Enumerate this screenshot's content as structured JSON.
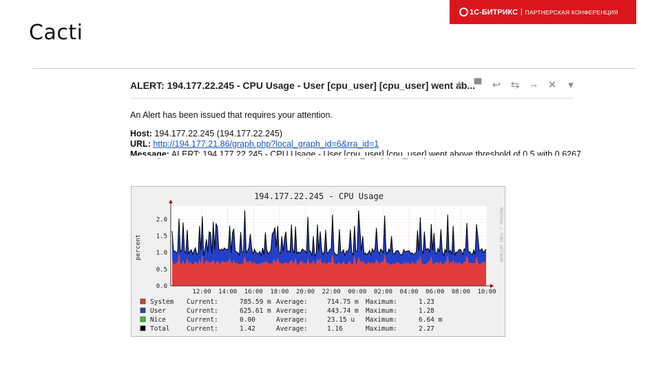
{
  "slide": {
    "title": "Cacti",
    "brand_name": "1С-БИТРИКС",
    "brand_separator": "|",
    "brand_tagline": "ПАРТНЕРСКАЯ КОНФЕРЕНЦИЯ",
    "brand_color": "#d9161c"
  },
  "email": {
    "subject": "ALERT: 194.177.22.245 - CPU Usage - User [cpu_user] [cpu_user] went ab...",
    "actions": [
      {
        "name": "star-icon",
        "glyph": "★"
      },
      {
        "name": "label-icon",
        "glyph": "▀"
      },
      {
        "name": "reply-icon",
        "glyph": "↩"
      },
      {
        "name": "reply-all-icon",
        "glyph": "⇆"
      },
      {
        "name": "forward-icon",
        "glyph": "→"
      },
      {
        "name": "delete-icon",
        "glyph": "✕"
      },
      {
        "name": "more-icon",
        "glyph": "▾"
      }
    ],
    "intro": "An Alert has been issued that requires your attention.",
    "host_label": "Host:",
    "host_value": "194.177.22.245 (194.177.22.245)",
    "url_label": "URL:",
    "url_value": "http://194.177.21.86/graph.php?local_graph_id=6&rra_id=1",
    "message_label": "Message:",
    "message_value": "ALERT: 194.177.22.245 - CPU Usage - User [cpu_user] [cpu_user] went above threshold of 0.5 with 0.6267"
  },
  "graph": {
    "title": "194.177.22.245 - CPU Usage",
    "ylabel": "percent",
    "watermark": "RRDTOOL / TOBI OETIKER",
    "legend": [
      {
        "name": "System",
        "color": "#e23b3b",
        "current": "785.59 m",
        "average": "714.75 m",
        "maximum": "1.23"
      },
      {
        "name": "User",
        "color": "#2540c8",
        "current": "625.61 m",
        "average": "443.74 m",
        "maximum": "1.28"
      },
      {
        "name": "Nice",
        "color": "#3fbf3f",
        "current": "0.00",
        "average": "23.15 u",
        "maximum": "6.64 m"
      },
      {
        "name": "Total",
        "color": "#000000",
        "current": "1.42",
        "average": "1.16",
        "maximum": "2.27"
      }
    ],
    "legend_labels": {
      "current": "Current:",
      "average": "Average:",
      "maximum": "Maximum:"
    }
  },
  "chart_data": {
    "type": "area",
    "title": "194.177.22.245 - CPU Usage",
    "ylabel": "percent",
    "xlabel": "",
    "x_ticks": [
      "12:00",
      "14:00",
      "16:00",
      "18:00",
      "20:00",
      "22:00",
      "00:00",
      "02:00",
      "04:00",
      "06:00",
      "08:00",
      "10:00"
    ],
    "y_ticks": [
      "0.0",
      "0.5",
      "1.0",
      "1.5",
      "2.0"
    ],
    "ylim": [
      0,
      2.4
    ],
    "series": [
      {
        "name": "System",
        "color": "#e23b3b",
        "average": 0.71475,
        "base_level": 0.68
      },
      {
        "name": "User",
        "color": "#2540c8",
        "average": 0.44374,
        "base_level": 0.35
      },
      {
        "name": "Nice",
        "color": "#3fbf3f",
        "average": 0.0
      },
      {
        "name": "Total",
        "color": "#000000",
        "average": 1.16,
        "max": 2.27
      }
    ],
    "grid": true,
    "legend_position": "bottom"
  }
}
